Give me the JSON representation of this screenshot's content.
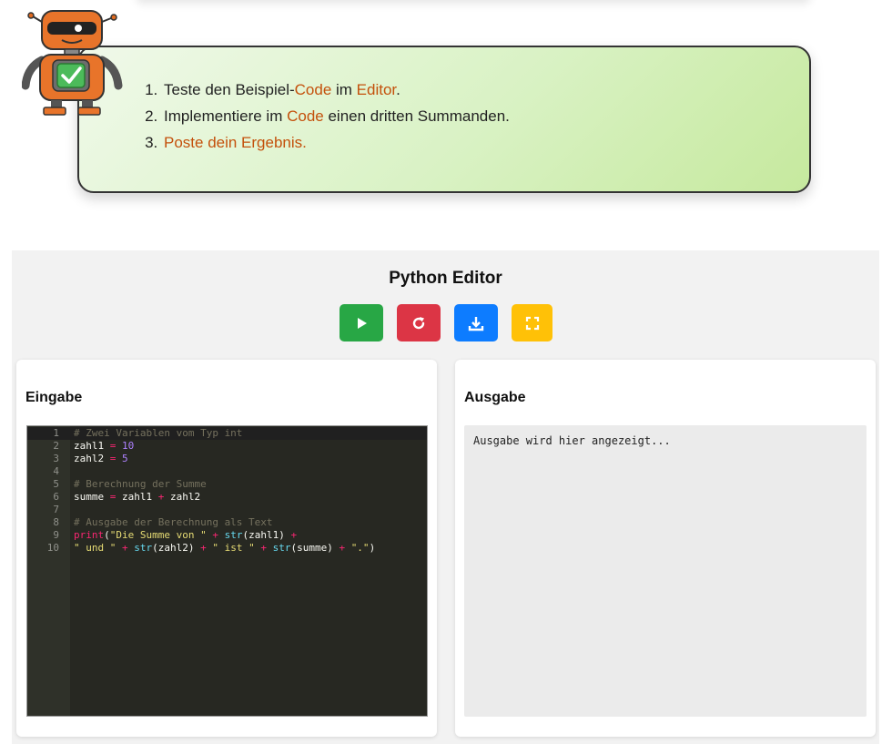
{
  "tasks": {
    "items": [
      [
        {
          "t": "Teste den Beispiel-",
          "h": false
        },
        {
          "t": "Code",
          "h": true
        },
        {
          "t": " im ",
          "h": false
        },
        {
          "t": "Editor",
          "h": true
        },
        {
          "t": ".",
          "h": false
        }
      ],
      [
        {
          "t": "Implementiere im ",
          "h": false
        },
        {
          "t": "Code",
          "h": true
        },
        {
          "t": " einen dritten Summanden.",
          "h": false
        }
      ],
      [
        {
          "t": "Poste dein Ergebnis.",
          "h": true
        }
      ]
    ],
    "highlight_color": "#c4510c"
  },
  "editor": {
    "title": "Python Editor",
    "buttons": [
      {
        "name": "run-button",
        "icon": "play-icon",
        "color": "#28a745"
      },
      {
        "name": "reset-button",
        "icon": "refresh-icon",
        "color": "#dc3545"
      },
      {
        "name": "download-button",
        "icon": "download-icon",
        "color": "#0d7cff"
      },
      {
        "name": "fullscreen-button",
        "icon": "fullscreen-icon",
        "color": "#ffc107"
      }
    ],
    "input": {
      "title": "Eingabe",
      "code_lines": [
        {
          "n": "1",
          "tokens": [
            [
              "c",
              "# Zwei Variablen vom Typ int"
            ]
          ]
        },
        {
          "n": "2",
          "tokens": [
            [
              "i",
              "zahl1 "
            ],
            [
              "o",
              "="
            ],
            [
              "i",
              " "
            ],
            [
              "n",
              "10"
            ]
          ]
        },
        {
          "n": "3",
          "tokens": [
            [
              "i",
              "zahl2 "
            ],
            [
              "o",
              "="
            ],
            [
              "i",
              " "
            ],
            [
              "n",
              "5"
            ]
          ]
        },
        {
          "n": "4",
          "tokens": []
        },
        {
          "n": "5",
          "tokens": [
            [
              "c",
              "# Berechnung der Summe"
            ]
          ]
        },
        {
          "n": "6",
          "tokens": [
            [
              "i",
              "summe "
            ],
            [
              "o",
              "="
            ],
            [
              "i",
              " zahl1 "
            ],
            [
              "o",
              "+"
            ],
            [
              "i",
              " zahl2"
            ]
          ]
        },
        {
          "n": "7",
          "tokens": []
        },
        {
          "n": "8",
          "tokens": [
            [
              "c",
              "# Ausgabe der Berechnung als Text"
            ]
          ]
        },
        {
          "n": "9",
          "tokens": [
            [
              "k",
              "print"
            ],
            [
              "i",
              "("
            ],
            [
              "s",
              "\"Die Summe von \""
            ],
            [
              "i",
              " "
            ],
            [
              "o",
              "+"
            ],
            [
              "i",
              " "
            ],
            [
              "f",
              "str"
            ],
            [
              "i",
              "(zahl1) "
            ],
            [
              "o",
              "+"
            ]
          ]
        },
        {
          "n": "10",
          "tokens": [
            [
              "s",
              "\" und \""
            ],
            [
              "i",
              " "
            ],
            [
              "o",
              "+"
            ],
            [
              "i",
              " "
            ],
            [
              "f",
              "str"
            ],
            [
              "i",
              "(zahl2) "
            ],
            [
              "o",
              "+"
            ],
            [
              "i",
              " "
            ],
            [
              "s",
              "\" ist \""
            ],
            [
              "i",
              " "
            ],
            [
              "o",
              "+"
            ],
            [
              "i",
              " "
            ],
            [
              "f",
              "str"
            ],
            [
              "i",
              "(summe) "
            ],
            [
              "o",
              "+"
            ],
            [
              "i",
              " "
            ],
            [
              "s",
              "\".\""
            ],
            [
              "i",
              ")"
            ]
          ]
        }
      ]
    },
    "output": {
      "title": "Ausgabe",
      "placeholder": "Ausgabe wird hier angezeigt..."
    }
  }
}
